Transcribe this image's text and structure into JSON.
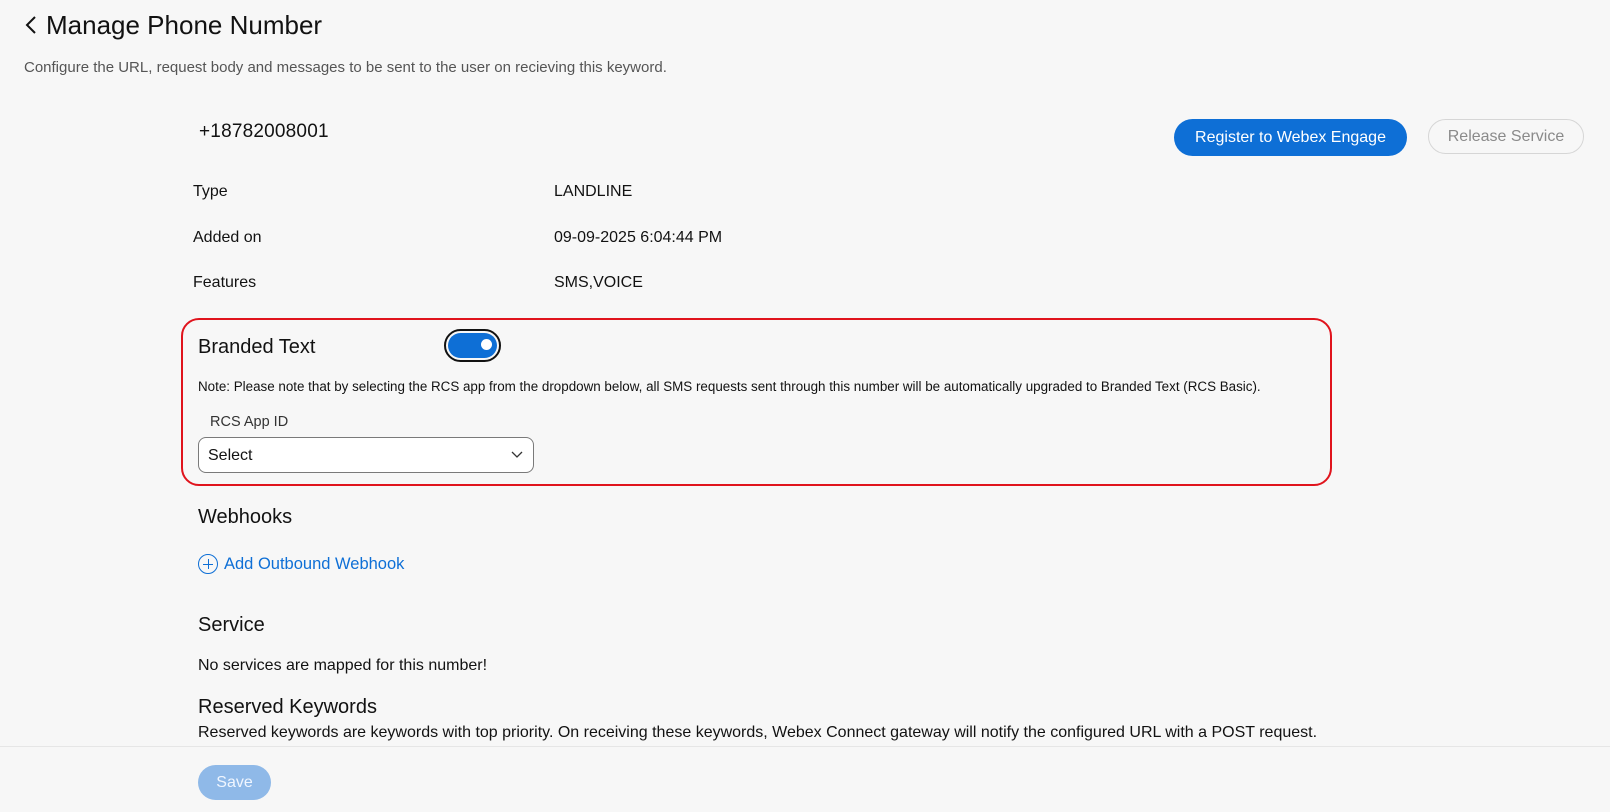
{
  "header": {
    "title": "Manage Phone Number",
    "subtitle": "Configure the URL, request body and messages to be sent to the user on recieving this keyword."
  },
  "phone": {
    "number": "+18782008001",
    "register_label": "Register to Webex Engage",
    "release_label": "Release Service"
  },
  "details": [
    {
      "label": "Type",
      "value": "LANDLINE"
    },
    {
      "label": "Added on",
      "value": "09-09-2025 6:04:44 PM"
    },
    {
      "label": "Features",
      "value": "SMS,VOICE"
    }
  ],
  "branded_text": {
    "title": "Branded Text",
    "enabled": true,
    "note": "Note: Please note that by selecting the RCS app from the dropdown below, all SMS requests sent through this number will be automatically upgraded to Branded Text (RCS Basic).",
    "rcs_label": "RCS App ID",
    "rcs_value": "Select"
  },
  "webhooks": {
    "title": "Webhooks",
    "add_label": "Add Outbound Webhook"
  },
  "service": {
    "title": "Service",
    "empty_text": "No services are mapped for this number!"
  },
  "reserved": {
    "title": "Reserved Keywords",
    "description": "Reserved keywords are keywords with top priority. On receiving these keywords, Webex Connect gateway will notify the configured URL with a POST request."
  },
  "footer": {
    "save_label": "Save"
  },
  "colors": {
    "accent": "#0e6fd6",
    "highlight_border": "#e0141d"
  }
}
